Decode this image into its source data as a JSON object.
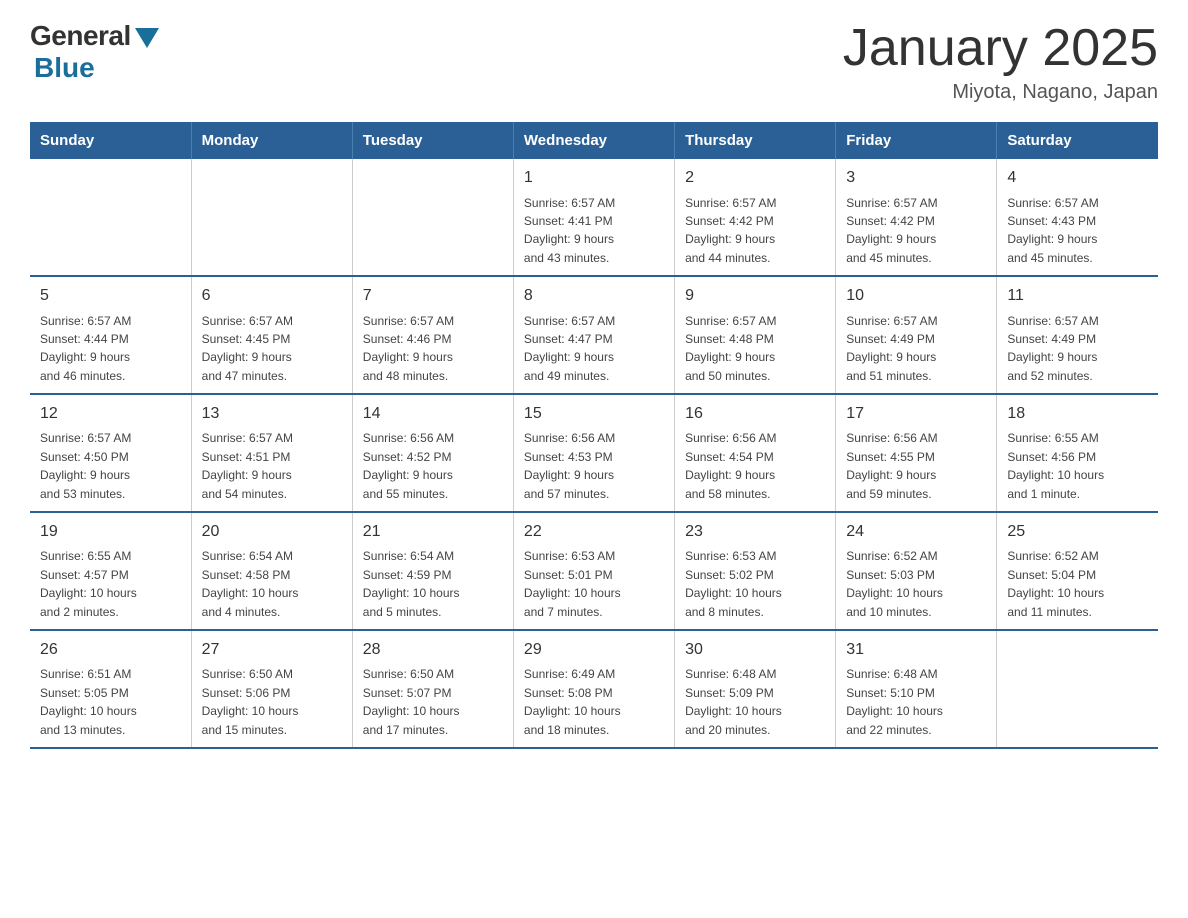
{
  "header": {
    "logo_general": "General",
    "logo_blue": "Blue",
    "title": "January 2025",
    "subtitle": "Miyota, Nagano, Japan"
  },
  "weekdays": [
    "Sunday",
    "Monday",
    "Tuesday",
    "Wednesday",
    "Thursday",
    "Friday",
    "Saturday"
  ],
  "weeks": [
    [
      {
        "day": "",
        "info": ""
      },
      {
        "day": "",
        "info": ""
      },
      {
        "day": "",
        "info": ""
      },
      {
        "day": "1",
        "info": "Sunrise: 6:57 AM\nSunset: 4:41 PM\nDaylight: 9 hours\nand 43 minutes."
      },
      {
        "day": "2",
        "info": "Sunrise: 6:57 AM\nSunset: 4:42 PM\nDaylight: 9 hours\nand 44 minutes."
      },
      {
        "day": "3",
        "info": "Sunrise: 6:57 AM\nSunset: 4:42 PM\nDaylight: 9 hours\nand 45 minutes."
      },
      {
        "day": "4",
        "info": "Sunrise: 6:57 AM\nSunset: 4:43 PM\nDaylight: 9 hours\nand 45 minutes."
      }
    ],
    [
      {
        "day": "5",
        "info": "Sunrise: 6:57 AM\nSunset: 4:44 PM\nDaylight: 9 hours\nand 46 minutes."
      },
      {
        "day": "6",
        "info": "Sunrise: 6:57 AM\nSunset: 4:45 PM\nDaylight: 9 hours\nand 47 minutes."
      },
      {
        "day": "7",
        "info": "Sunrise: 6:57 AM\nSunset: 4:46 PM\nDaylight: 9 hours\nand 48 minutes."
      },
      {
        "day": "8",
        "info": "Sunrise: 6:57 AM\nSunset: 4:47 PM\nDaylight: 9 hours\nand 49 minutes."
      },
      {
        "day": "9",
        "info": "Sunrise: 6:57 AM\nSunset: 4:48 PM\nDaylight: 9 hours\nand 50 minutes."
      },
      {
        "day": "10",
        "info": "Sunrise: 6:57 AM\nSunset: 4:49 PM\nDaylight: 9 hours\nand 51 minutes."
      },
      {
        "day": "11",
        "info": "Sunrise: 6:57 AM\nSunset: 4:49 PM\nDaylight: 9 hours\nand 52 minutes."
      }
    ],
    [
      {
        "day": "12",
        "info": "Sunrise: 6:57 AM\nSunset: 4:50 PM\nDaylight: 9 hours\nand 53 minutes."
      },
      {
        "day": "13",
        "info": "Sunrise: 6:57 AM\nSunset: 4:51 PM\nDaylight: 9 hours\nand 54 minutes."
      },
      {
        "day": "14",
        "info": "Sunrise: 6:56 AM\nSunset: 4:52 PM\nDaylight: 9 hours\nand 55 minutes."
      },
      {
        "day": "15",
        "info": "Sunrise: 6:56 AM\nSunset: 4:53 PM\nDaylight: 9 hours\nand 57 minutes."
      },
      {
        "day": "16",
        "info": "Sunrise: 6:56 AM\nSunset: 4:54 PM\nDaylight: 9 hours\nand 58 minutes."
      },
      {
        "day": "17",
        "info": "Sunrise: 6:56 AM\nSunset: 4:55 PM\nDaylight: 9 hours\nand 59 minutes."
      },
      {
        "day": "18",
        "info": "Sunrise: 6:55 AM\nSunset: 4:56 PM\nDaylight: 10 hours\nand 1 minute."
      }
    ],
    [
      {
        "day": "19",
        "info": "Sunrise: 6:55 AM\nSunset: 4:57 PM\nDaylight: 10 hours\nand 2 minutes."
      },
      {
        "day": "20",
        "info": "Sunrise: 6:54 AM\nSunset: 4:58 PM\nDaylight: 10 hours\nand 4 minutes."
      },
      {
        "day": "21",
        "info": "Sunrise: 6:54 AM\nSunset: 4:59 PM\nDaylight: 10 hours\nand 5 minutes."
      },
      {
        "day": "22",
        "info": "Sunrise: 6:53 AM\nSunset: 5:01 PM\nDaylight: 10 hours\nand 7 minutes."
      },
      {
        "day": "23",
        "info": "Sunrise: 6:53 AM\nSunset: 5:02 PM\nDaylight: 10 hours\nand 8 minutes."
      },
      {
        "day": "24",
        "info": "Sunrise: 6:52 AM\nSunset: 5:03 PM\nDaylight: 10 hours\nand 10 minutes."
      },
      {
        "day": "25",
        "info": "Sunrise: 6:52 AM\nSunset: 5:04 PM\nDaylight: 10 hours\nand 11 minutes."
      }
    ],
    [
      {
        "day": "26",
        "info": "Sunrise: 6:51 AM\nSunset: 5:05 PM\nDaylight: 10 hours\nand 13 minutes."
      },
      {
        "day": "27",
        "info": "Sunrise: 6:50 AM\nSunset: 5:06 PM\nDaylight: 10 hours\nand 15 minutes."
      },
      {
        "day": "28",
        "info": "Sunrise: 6:50 AM\nSunset: 5:07 PM\nDaylight: 10 hours\nand 17 minutes."
      },
      {
        "day": "29",
        "info": "Sunrise: 6:49 AM\nSunset: 5:08 PM\nDaylight: 10 hours\nand 18 minutes."
      },
      {
        "day": "30",
        "info": "Sunrise: 6:48 AM\nSunset: 5:09 PM\nDaylight: 10 hours\nand 20 minutes."
      },
      {
        "day": "31",
        "info": "Sunrise: 6:48 AM\nSunset: 5:10 PM\nDaylight: 10 hours\nand 22 minutes."
      },
      {
        "day": "",
        "info": ""
      }
    ]
  ]
}
